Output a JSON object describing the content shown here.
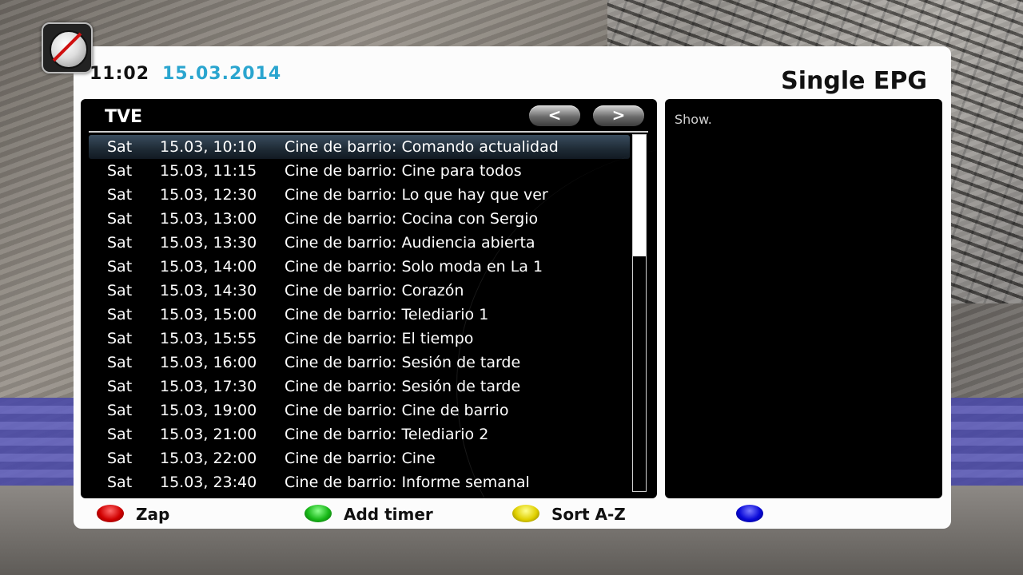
{
  "header": {
    "time": "11:02",
    "date": "15.03.2014",
    "title": "Single EPG"
  },
  "channel": {
    "name": "TVE",
    "prev_label": "<",
    "next_label": ">"
  },
  "events": [
    {
      "day": "Sat",
      "datetime": "15.03, 10:10",
      "title": "Cine de barrio: Comando actualidad",
      "selected": true
    },
    {
      "day": "Sat",
      "datetime": "15.03, 11:15",
      "title": "Cine de barrio: Cine para todos"
    },
    {
      "day": "Sat",
      "datetime": "15.03, 12:30",
      "title": "Cine de barrio: Lo que hay que ver"
    },
    {
      "day": "Sat",
      "datetime": "15.03, 13:00",
      "title": "Cine de barrio: Cocina con Sergio"
    },
    {
      "day": "Sat",
      "datetime": "15.03, 13:30",
      "title": "Cine de barrio: Audiencia abierta"
    },
    {
      "day": "Sat",
      "datetime": "15.03, 14:00",
      "title": "Cine de barrio: Solo moda en La 1"
    },
    {
      "day": "Sat",
      "datetime": "15.03, 14:30",
      "title": "Cine de barrio: Corazón"
    },
    {
      "day": "Sat",
      "datetime": "15.03, 15:00",
      "title": "Cine de barrio: Telediario 1"
    },
    {
      "day": "Sat",
      "datetime": "15.03, 15:55",
      "title": "Cine de barrio: El tiempo"
    },
    {
      "day": "Sat",
      "datetime": "15.03, 16:00",
      "title": "Cine de barrio: Sesión de tarde"
    },
    {
      "day": "Sat",
      "datetime": "15.03, 17:30",
      "title": "Cine de barrio: Sesión de tarde"
    },
    {
      "day": "Sat",
      "datetime": "15.03, 19:00",
      "title": "Cine de barrio: Cine de barrio"
    },
    {
      "day": "Sat",
      "datetime": "15.03, 21:00",
      "title": "Cine de barrio: Telediario 2"
    },
    {
      "day": "Sat",
      "datetime": "15.03, 22:00",
      "title": "Cine de barrio: Cine"
    },
    {
      "day": "Sat",
      "datetime": "15.03, 23:40",
      "title": "Cine de barrio: Informe semanal"
    }
  ],
  "description": {
    "text": "Show."
  },
  "buttons": {
    "red": {
      "label": "Zap",
      "color": "#d00000"
    },
    "green": {
      "label": "Add timer",
      "color": "#18b818"
    },
    "yellow": {
      "label": "Sort A-Z",
      "color": "#e0d000"
    },
    "blue": {
      "label": "",
      "color": "#0808d8"
    }
  },
  "colors": {
    "accent_date": "#2aa5cf",
    "panel_bg": "#fcfcfc",
    "list_bg": "#000000"
  }
}
